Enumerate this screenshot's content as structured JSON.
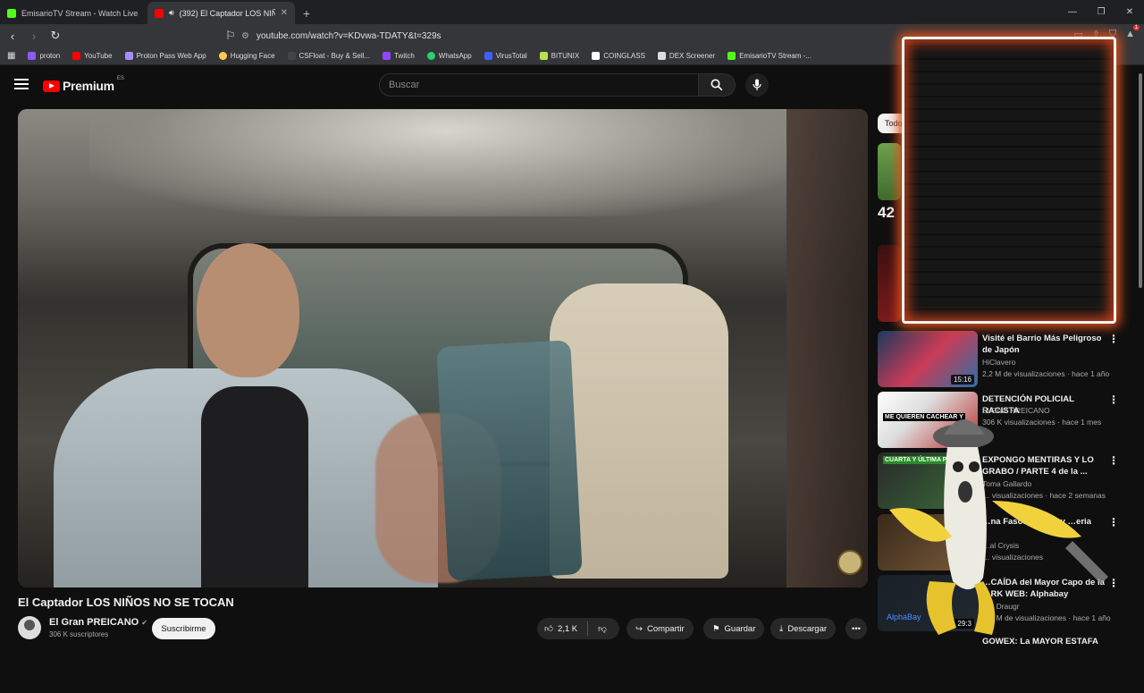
{
  "browser": {
    "tabs": [
      {
        "label": "EmisarioTV Stream - Watch Live on K",
        "active": false,
        "favicon_color": "#53fc18"
      },
      {
        "label": "(392) El Captador LOS NIÑOS",
        "active": true,
        "favicon_color": "#ff0000"
      }
    ],
    "new_tab": "+",
    "url": "youtube.com/watch?v=KDvwa-TDATY&t=329s",
    "bookmarks": [
      {
        "label": "proton",
        "color": "#8b5cf6"
      },
      {
        "label": "YouTube",
        "color": "#ff0000"
      },
      {
        "label": "Proton Pass Web App",
        "color": "#a78bfa"
      },
      {
        "label": "Hugging Face",
        "color": "#ffcc4d"
      },
      {
        "label": "CSFloat - Buy & Sell...",
        "color": "#444444"
      },
      {
        "label": "Twitch",
        "color": "#9146ff"
      },
      {
        "label": "WhatsApp",
        "color": "#25d366"
      },
      {
        "label": "VirusTotal",
        "color": "#3b61ff"
      },
      {
        "label": "BITUNIX",
        "color": "#b7e34a"
      },
      {
        "label": "COINGLASS",
        "color": "#ffffff"
      },
      {
        "label": "DEX Screener",
        "color": "#dddddd"
      },
      {
        "label": "EmisarioTV Stream -...",
        "color": "#53fc18"
      }
    ],
    "notification_count": "1"
  },
  "youtube": {
    "logo_text": "Premium",
    "country_code": "ES",
    "search_placeholder": "Buscar",
    "video": {
      "title": "El Captador LOS NIÑOS NO SE TOCAN",
      "channel": "El Gran PREICANO",
      "subscribers": "306 K suscriptores",
      "subscribe_label": "Suscribirme",
      "likes": "2,1 K",
      "share_label": "Compartir",
      "save_label": "Guardar",
      "download_label": "Descargar"
    },
    "chip_label": "Todos",
    "partial_number": "42",
    "recommendations": [
      {
        "title": "Visité el Barrio Más Peligroso de Japón",
        "channel": "HiClavero",
        "meta": "2,2 M de visualizaciones · hace 1 año",
        "duration": "15:16",
        "thumb_color": "#2f6fa3"
      },
      {
        "title": "DETENCIÓN POLICIAL RACISTA",
        "channel": "El Gran PREICANO",
        "meta": "306 K visualizaciones · hace 1 mes",
        "duration": "",
        "thumb_color": "#b92a2a",
        "thumb_text": "ME QUIEREN CACHEAR Y"
      },
      {
        "title": "EXPONGO MENTIRAS Y LO GRABO / PARTE 4 de la ...",
        "channel": "Toma Gallardo",
        "meta": "… visualizaciones · hace 2 semanas",
        "duration": "",
        "thumb_color": "#3a6b3a",
        "thumb_text": "CUARTA Y ÚLTIMA PA"
      },
      {
        "title": "…na Faso: … SMO y …eria",
        "channel": "…al Crysis",
        "meta": "… visualizaciones",
        "duration": "",
        "thumb_color": "#7a5a3a"
      },
      {
        "title": "…CAÍDA del Mayor Capo de la …RK WEB: Alphabay",
        "channel": "…d Draugr",
        "meta": "…6 M de visualizaciones · hace 1 año",
        "duration": "29:3",
        "thumb_color": "#202830",
        "thumb_text": "AlphaBay"
      },
      {
        "title": "GOWEX: La MAYOR ESTAFA",
        "channel": "",
        "meta": "",
        "duration": "",
        "thumb_color": "#333333"
      }
    ]
  }
}
